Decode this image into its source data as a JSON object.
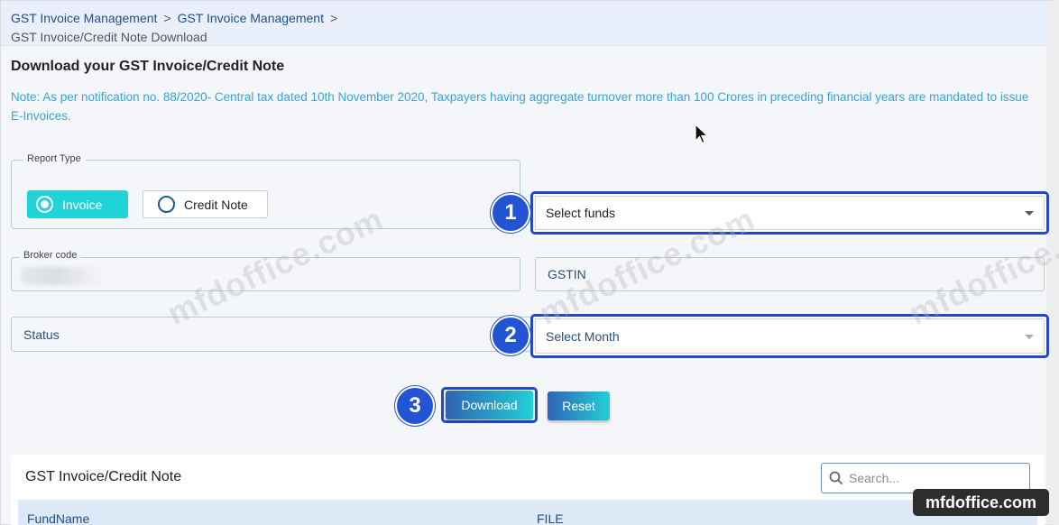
{
  "breadcrumb": {
    "items": [
      "GST Invoice Management",
      "GST Invoice Management"
    ],
    "separator": ">",
    "current": "GST Invoice/Credit Note Download"
  },
  "page": {
    "title": "Download your GST Invoice/Credit Note",
    "note": "Note: As per notification no. 88/2020- Central tax dated 10th November 2020, Taxpayers having aggregate turnover more than 100 Crores in preceding financial years are mandated to issue E-Invoices."
  },
  "form": {
    "report_type_label": "Report Type",
    "report_options": [
      {
        "label": "Invoice",
        "selected": true
      },
      {
        "label": "Credit Note",
        "selected": false
      }
    ],
    "funds_select": "Select funds",
    "broker_code_label": "Broker code",
    "gstin_placeholder": "GSTIN",
    "status_placeholder": "Status",
    "month_select": "Select Month"
  },
  "steps": [
    "1",
    "2",
    "3"
  ],
  "buttons": {
    "download": "Download",
    "reset": "Reset"
  },
  "table": {
    "title": "GST Invoice/Credit Note",
    "search_placeholder": "Search...",
    "columns": [
      "FundName",
      "FILE"
    ]
  },
  "watermark_text": "mfdoffice.com",
  "brand_badge": "mfdoffice.com",
  "colors": {
    "accent_cyan": "#1fd3d8",
    "highlight_blue": "#2449c7",
    "link_blue": "#1f4e8c",
    "note_blue": "#3aa3d4"
  }
}
